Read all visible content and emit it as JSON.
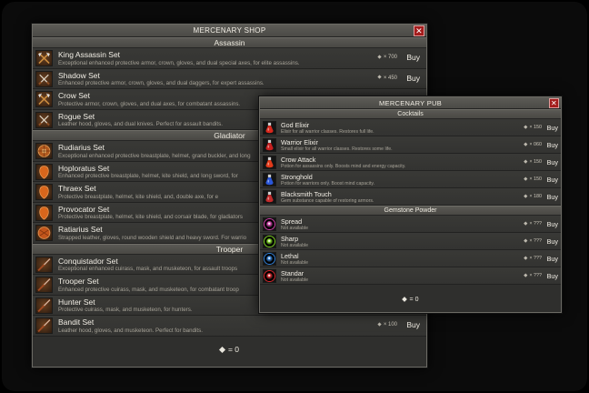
{
  "shop": {
    "title": "MERCENARY SHOP",
    "close_label": "✕",
    "sections": [
      {
        "name": "Assassin",
        "items": [
          {
            "name": "King Assassin Set",
            "desc": "Exceptional enhanced protective armor, crown, gloves, and dual special axes, for elite assassins.",
            "price": "× 700",
            "buy": "Buy",
            "icon": "crossed-axes-icon"
          },
          {
            "name": "Shadow Set",
            "desc": "Enhanced protective armor, crown, gloves, and dual daggers, for expert assassins.",
            "price": "× 450",
            "buy": "Buy",
            "icon": "crossed-daggers-icon"
          },
          {
            "name": "Crow Set",
            "desc": "Protective armor, crown, gloves, and dual axes, for combatant assassins.",
            "price": "",
            "buy": "",
            "icon": "crossed-axes-icon"
          },
          {
            "name": "Rogue Set",
            "desc": "Leather hood, gloves, and dual knives. Perfect for assault bandits.",
            "price": "",
            "buy": "",
            "icon": "crossed-knives-icon"
          }
        ]
      },
      {
        "name": "Gladiator",
        "items": [
          {
            "name": "Rudiarius Set",
            "desc": "Exceptional enhanced protective breastplate, helmet, grand buckler, and long",
            "price": "",
            "buy": "",
            "icon": "buckler-icon"
          },
          {
            "name": "Hoploratus Set",
            "desc": "Enhanced protective breastplate, helmet, kite shield, and long sword, for",
            "price": "",
            "buy": "",
            "icon": "kite-shield-icon"
          },
          {
            "name": "Thraex Set",
            "desc": "Protective breastplate, helmet, kite shield, and, double axe, for e",
            "price": "",
            "buy": "",
            "icon": "kite-shield-icon"
          },
          {
            "name": "Provocator Set",
            "desc": "Protective breastplate, helmet, kite shield, and corsair blade, for gladiators",
            "price": "",
            "buy": "",
            "icon": "kite-shield-icon"
          },
          {
            "name": "Ratiarius Set",
            "desc": "Strapped leather, gloves, round wooden shield and heavy sword. For warrio",
            "price": "",
            "buy": "",
            "icon": "round-shield-icon"
          }
        ]
      },
      {
        "name": "Trooper",
        "items": [
          {
            "name": "Conquistador Set",
            "desc": "Exceptional enhanced cuirass, mask, and musketeon, for assault troops",
            "price": "",
            "buy": "",
            "icon": "musket-icon"
          },
          {
            "name": "Trooper Set",
            "desc": "Enhanced protective cuirass, mask, and musketeon, for combatant troop",
            "price": "",
            "buy": "",
            "icon": "musket-icon"
          },
          {
            "name": "Hunter Set",
            "desc": "Protective cuirass, mask, and musketeon, for hunters.",
            "price": "",
            "buy": "",
            "icon": "musket-icon"
          },
          {
            "name": "Bandit Set",
            "desc": "Leather hood, gloves, and musketeon. Perfect for bandits.",
            "price": "× 100",
            "buy": "Buy",
            "icon": "musket-icon"
          }
        ]
      }
    ],
    "balance": "= 0"
  },
  "pub": {
    "title": "MERCENARY PUB",
    "close_label": "✕",
    "sections": [
      {
        "name": "Cocktails",
        "items": [
          {
            "name": "God Elixir",
            "desc": "Elixir for all warrior classes. Restores full life.",
            "price": "× 150",
            "buy": "Buy",
            "color": "#d8271c"
          },
          {
            "name": "Warrior Elixir",
            "desc": "Small elixir for all warrior classes. Restores some life.",
            "price": "× 060",
            "buy": "Buy",
            "color": "#c81f1f"
          },
          {
            "name": "Crow Attack",
            "desc": "Potion for assassins only. Boosts mind and energy capacity.",
            "price": "× 150",
            "buy": "Buy",
            "color": "#e23a1a"
          },
          {
            "name": "Stronghold",
            "desc": "Potion for warriors only. Boost mind capacity.",
            "price": "× 150",
            "buy": "Buy",
            "color": "#2a56d8"
          },
          {
            "name": "Blacksmith Touch",
            "desc": "Gem substance capable of restoring armors.",
            "price": "× 180",
            "buy": "Buy",
            "color": "#c22a2a"
          }
        ]
      },
      {
        "name": "Gemstone Powder",
        "items": [
          {
            "name": "Spread",
            "desc": "Not available",
            "price": "× ???",
            "buy": "Buy",
            "color": "#cf3fa8"
          },
          {
            "name": "Sharp",
            "desc": "Not available",
            "price": "× ???",
            "buy": "Buy",
            "color": "#7ed321"
          },
          {
            "name": "Lethal",
            "desc": "Not available",
            "price": "× ???",
            "buy": "Buy",
            "color": "#2f7fd6"
          },
          {
            "name": "Standar",
            "desc": "Not available",
            "price": "× ???",
            "buy": "Buy",
            "color": "#d7262b"
          }
        ]
      }
    ],
    "balance": "= 0"
  }
}
